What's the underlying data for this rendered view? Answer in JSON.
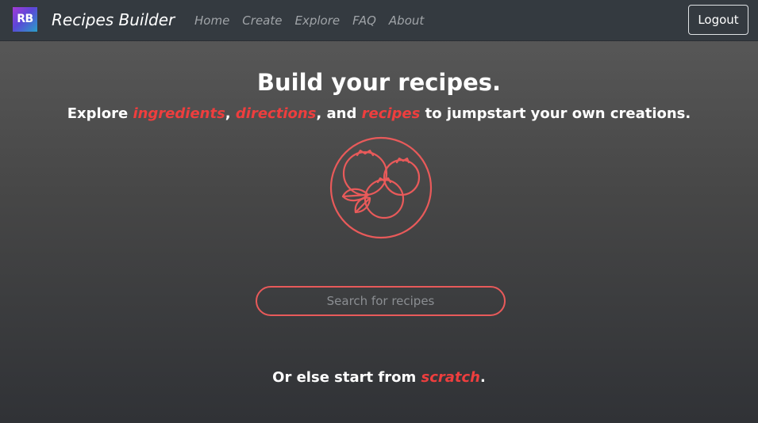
{
  "navbar": {
    "logo_text": "RB",
    "brand": "Recipes Builder",
    "links": [
      "Home",
      "Create",
      "Explore",
      "FAQ",
      "About"
    ],
    "logout_label": "Logout"
  },
  "hero": {
    "title": "Build your recipes.",
    "sub_prefix": "Explore ",
    "sub_ingredients": "ingredients",
    "sub_comma1": ", ",
    "sub_directions": "directions",
    "sub_and": ", and ",
    "sub_recipes": "recipes",
    "sub_suffix": " to jumpstart your own creations.",
    "icon": "berries-icon"
  },
  "search": {
    "placeholder": "Search for recipes",
    "value": ""
  },
  "footer_cta": {
    "prefix": "Or else start from ",
    "link": "scratch",
    "suffix": "."
  },
  "colors": {
    "accent": "#ee3e3e",
    "navbar_bg": "#343a40",
    "icon_stroke": "#e85a5a"
  }
}
